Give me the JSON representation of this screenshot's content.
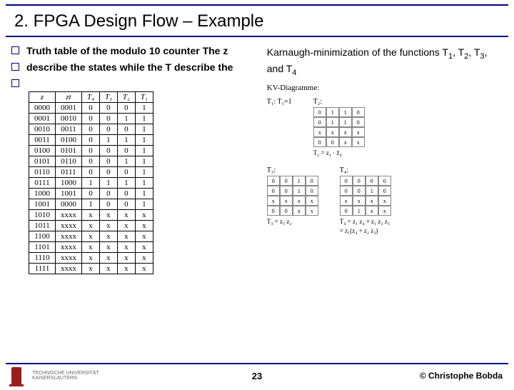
{
  "title": "2. FPGA Design Flow – Example",
  "bullets": {
    "b1": "Truth table of the modulo 10 counter The z",
    "b2": "describe the states while the T  describe the"
  },
  "right_intro_a": "Karnaugh-minimization of the functions T",
  "right_intro_b": ", T",
  "right_intro_c": ", T",
  "right_intro_d": ", and T",
  "subs": {
    "s1": "1",
    "s2": "2",
    "s3": "3",
    "s4": "4"
  },
  "table": {
    "headers": [
      "z",
      "zt",
      "T₄",
      "T₃",
      "T₂",
      "T₁"
    ],
    "rows": [
      [
        "0000",
        "0001",
        "0",
        "0",
        "0",
        "1"
      ],
      [
        "0001",
        "0010",
        "0",
        "0",
        "1",
        "1"
      ],
      [
        "0010",
        "0011",
        "0",
        "0",
        "0",
        "1"
      ],
      [
        "0011",
        "0100",
        "0",
        "1",
        "1",
        "1"
      ],
      [
        "0100",
        "0101",
        "0",
        "0",
        "0",
        "1"
      ],
      [
        "0101",
        "0110",
        "0",
        "0",
        "1",
        "1"
      ],
      [
        "0110",
        "0111",
        "0",
        "0",
        "0",
        "1"
      ],
      [
        "0111",
        "1000",
        "1",
        "1",
        "1",
        "1"
      ],
      [
        "1000",
        "1001",
        "0",
        "0",
        "0",
        "1"
      ],
      [
        "1001",
        "0000",
        "1",
        "0",
        "0",
        "1"
      ],
      [
        "1010",
        "xxxx",
        "x",
        "x",
        "x",
        "x"
      ],
      [
        "1011",
        "xxxx",
        "x",
        "x",
        "x",
        "x"
      ],
      [
        "1100",
        "xxxx",
        "x",
        "x",
        "x",
        "x"
      ],
      [
        "1101",
        "xxxx",
        "x",
        "x",
        "x",
        "x"
      ],
      [
        "1110",
        "xxxx",
        "x",
        "x",
        "x",
        "x"
      ],
      [
        "1111",
        "xxxx",
        "x",
        "x",
        "x",
        "x"
      ]
    ]
  },
  "kv": {
    "heading": "KV-Diagramme:",
    "m1_label": "T₁: T₁=1",
    "m2_label": "T₂:",
    "m3_label": "T₃:",
    "m4_label": "T₄:",
    "m2_cells": [
      "0",
      "1",
      "1",
      "0",
      "0",
      "1",
      "1",
      "0",
      "x",
      "x",
      "x",
      "x",
      "0",
      "0",
      "x",
      "x"
    ],
    "m3_cells": [
      "0",
      "0",
      "1",
      "0",
      "0",
      "0",
      "1",
      "0",
      "x",
      "x",
      "x",
      "x",
      "0",
      "0",
      "x",
      "x"
    ],
    "m4_cells": [
      "0",
      "0",
      "0",
      "0",
      "0",
      "0",
      "1",
      "0",
      "x",
      "x",
      "x",
      "x",
      "0",
      "1",
      "x",
      "x"
    ],
    "r2": "T₂ = z₁ · z̄₄",
    "r3": "T₃ = z₁ z₂",
    "r4a": "T₄ = z₁ z₄ + z₁ z₂ z₃",
    "r4b": "= z₁(z₄ + z₂ z₃)"
  },
  "footer": {
    "uni1": "TECHNISCHE UNIVERSITÄT",
    "uni2": "KAISERSLAUTERN",
    "page": "23",
    "copy": "©  Christophe Bobda"
  }
}
